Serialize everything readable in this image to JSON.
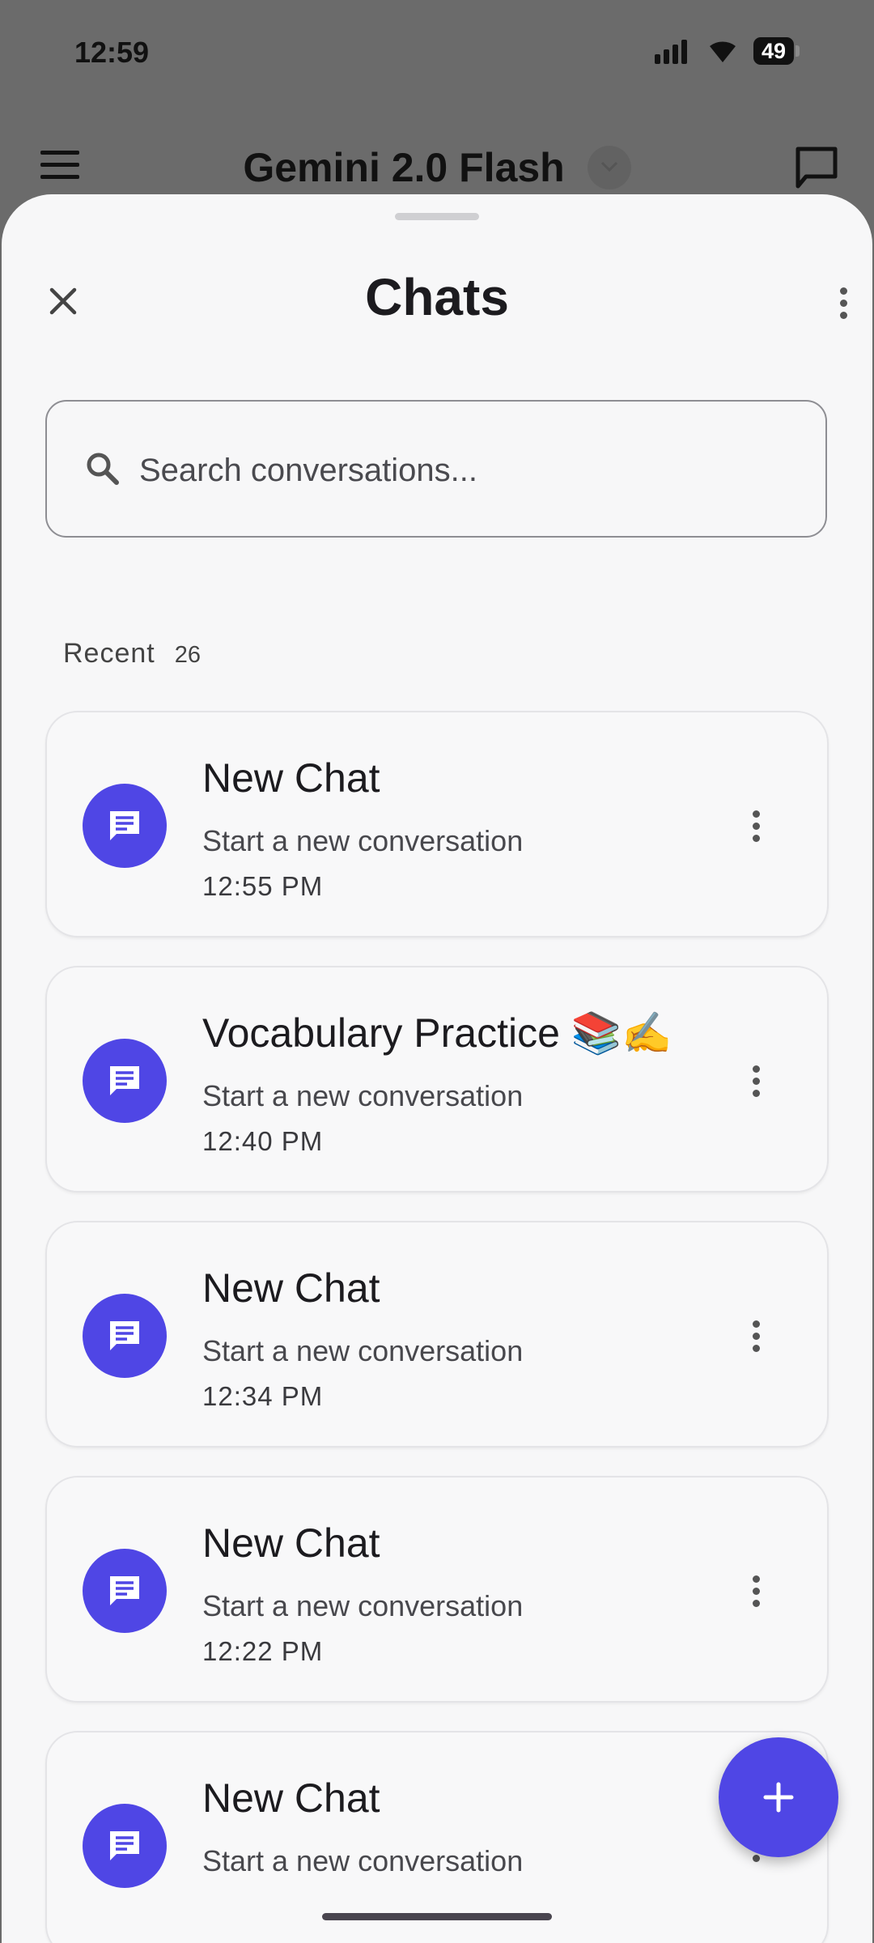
{
  "status_bar": {
    "time": "12:59",
    "battery": "49"
  },
  "app_bar": {
    "model_title": "Gemini 2.0 Flash"
  },
  "sheet": {
    "title": "Chats",
    "search": {
      "placeholder": "Search conversations..."
    },
    "section": {
      "label": "Recent",
      "count": "26"
    },
    "chats": [
      {
        "title": "New Chat",
        "subtitle": "Start a new conversation",
        "time": "12:55 PM"
      },
      {
        "title": "Vocabulary Practice 📚✍️",
        "subtitle": "Start a new conversation",
        "time": "12:40 PM"
      },
      {
        "title": "New Chat",
        "subtitle": "Start a new conversation",
        "time": "12:34 PM"
      },
      {
        "title": "New Chat",
        "subtitle": "Start a new conversation",
        "time": "12:22 PM"
      },
      {
        "title": "New Chat",
        "subtitle": "Start a new conversation",
        "time": ""
      }
    ]
  },
  "colors": {
    "accent": "#4f46e5",
    "scrim": "#6b6b6b",
    "sheet_bg": "#f7f7f8"
  },
  "icons": [
    "menu-icon",
    "chevron-down-icon",
    "new-chat-icon",
    "close-icon",
    "more-vert-icon",
    "search-icon",
    "chat-bubble-icon",
    "plus-icon"
  ]
}
